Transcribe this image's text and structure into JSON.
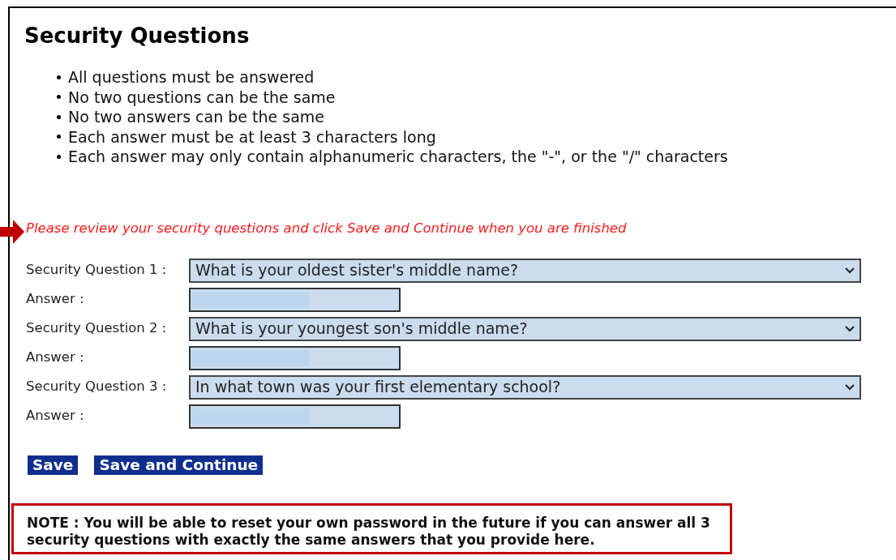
{
  "title": "Security Questions",
  "rules": [
    "All questions must be answered",
    "No two questions can be the same",
    "No two answers can be the same",
    "Each answer must be at least 3 characters long",
    "Each answer may only contain alphanumeric characters, the \"-\", or the \"/\" characters"
  ],
  "message": "Please review your security questions and click Save and Continue when you are finished",
  "questions": [
    {
      "label": "Security Question 1 :",
      "value": "What is your oldest sister's middle name?",
      "answer_label": "Answer :",
      "answer_redacted": true
    },
    {
      "label": "Security Question 2 :",
      "value": "What is your youngest son's middle name?",
      "answer_label": "Answer :",
      "answer_redacted": true
    },
    {
      "label": "Security Question 3 :",
      "value": "In what town was your first elementary school?",
      "answer_label": "Answer :",
      "answer_redacted": true
    }
  ],
  "buttons": [
    "Save",
    "Save and Continue"
  ],
  "note": "NOTE : You will be able to reset your own password in the future if you can answer all 3 security questions with exactly the same answers that you provide here."
}
